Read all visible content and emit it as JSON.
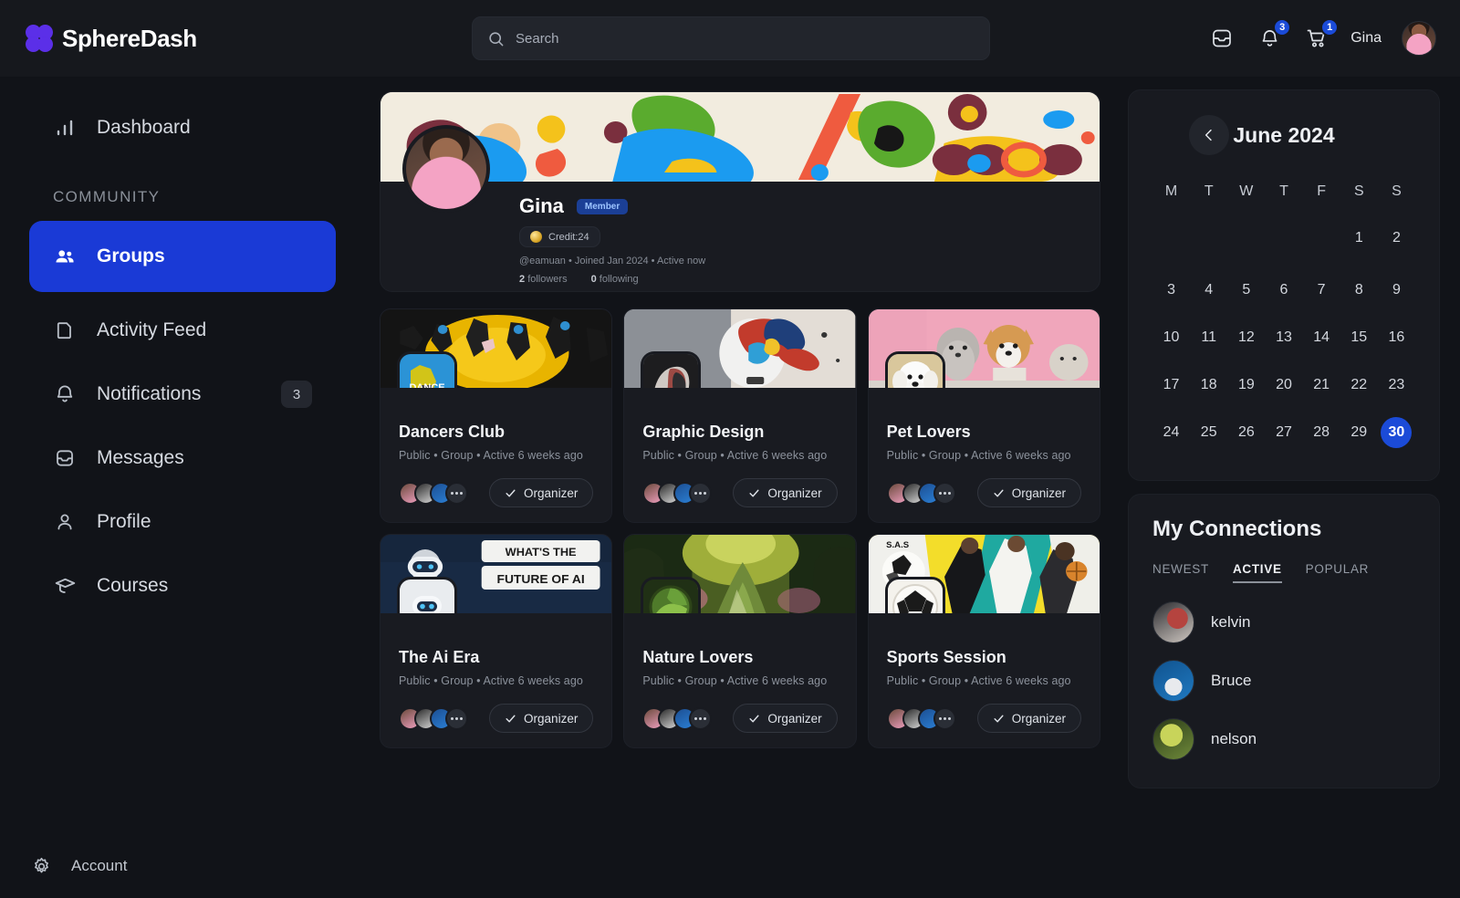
{
  "brand": {
    "name": "SphereDash"
  },
  "search": {
    "placeholder": "Search"
  },
  "topbar": {
    "inbox_icon": "inbox-icon",
    "bell_icon": "bell-icon",
    "bell_badge": "3",
    "cart_icon": "cart-icon",
    "cart_badge": "1",
    "user_name": "Gina"
  },
  "sidebar": {
    "dashboard": {
      "label": "Dashboard",
      "icon": "bar-chart-icon"
    },
    "section_label": "COMMUNITY",
    "items": [
      {
        "label": "Groups",
        "icon": "people-icon",
        "active": true,
        "count": ""
      },
      {
        "label": "Activity Feed",
        "icon": "document-icon",
        "active": false,
        "count": ""
      },
      {
        "label": "Notifications",
        "icon": "bell-icon",
        "active": false,
        "count": "3"
      },
      {
        "label": "Messages",
        "icon": "inbox-icon",
        "active": false,
        "count": ""
      },
      {
        "label": "Profile",
        "icon": "user-icon",
        "active": false,
        "count": ""
      },
      {
        "label": "Courses",
        "icon": "graduation-cap-icon",
        "active": false,
        "count": ""
      }
    ],
    "account": {
      "label": "Account",
      "icon": "gear-icon"
    }
  },
  "profile": {
    "name": "Gina",
    "badge": "Member",
    "credit": "Credit:24",
    "meta": "@eamuan  •  Joined Jan 2024  •  Active now",
    "followers_count": "2",
    "followers_label": "followers",
    "following_count": "0",
    "following_label": "following"
  },
  "groups": [
    {
      "title": "Dancers Club",
      "meta": "Public  •  Group  •  Active 6 weeks ago",
      "action": "Organizer"
    },
    {
      "title": "Graphic Design",
      "meta": "Public  •  Group  •  Active 6 weeks ago",
      "action": "Organizer"
    },
    {
      "title": "Pet Lovers",
      "meta": "Public  •  Group  •  Active 6 weeks ago",
      "action": "Organizer"
    },
    {
      "title": "The Ai Era",
      "meta": "Public  •  Group  •  Active 6 weeks ago",
      "action": "Organizer"
    },
    {
      "title": "Nature Lovers",
      "meta": "Public  •  Group  •  Active 6 weeks ago",
      "action": "Organizer"
    },
    {
      "title": "Sports Session",
      "meta": "Public  •  Group  •  Active 6 weeks ago",
      "action": "Organizer"
    }
  ],
  "calendar": {
    "title": "June 2024",
    "prev_icon": "chevron-left-icon",
    "dow": [
      "M",
      "T",
      "W",
      "T",
      "F",
      "S",
      "S"
    ],
    "lead_blanks": 5,
    "days": [
      1,
      2,
      3,
      4,
      5,
      6,
      7,
      8,
      9,
      10,
      11,
      12,
      13,
      14,
      15,
      16,
      17,
      18,
      19,
      20,
      21,
      22,
      23,
      24,
      25,
      26,
      27,
      28,
      29,
      30
    ],
    "selected": 30
  },
  "connections": {
    "title": "My Connections",
    "tabs": [
      {
        "label": "NEWEST",
        "active": false
      },
      {
        "label": "ACTIVE",
        "active": true
      },
      {
        "label": "POPULAR",
        "active": false
      }
    ],
    "items": [
      {
        "name": "kelvin"
      },
      {
        "name": "Bruce"
      },
      {
        "name": "nelson"
      }
    ]
  },
  "colors": {
    "accent_blue": "#1a3ad6",
    "badge_blue": "#1b4bd8",
    "brand_purple": "#5b2fe8",
    "bg": "#111318",
    "panel": "#191b21"
  }
}
